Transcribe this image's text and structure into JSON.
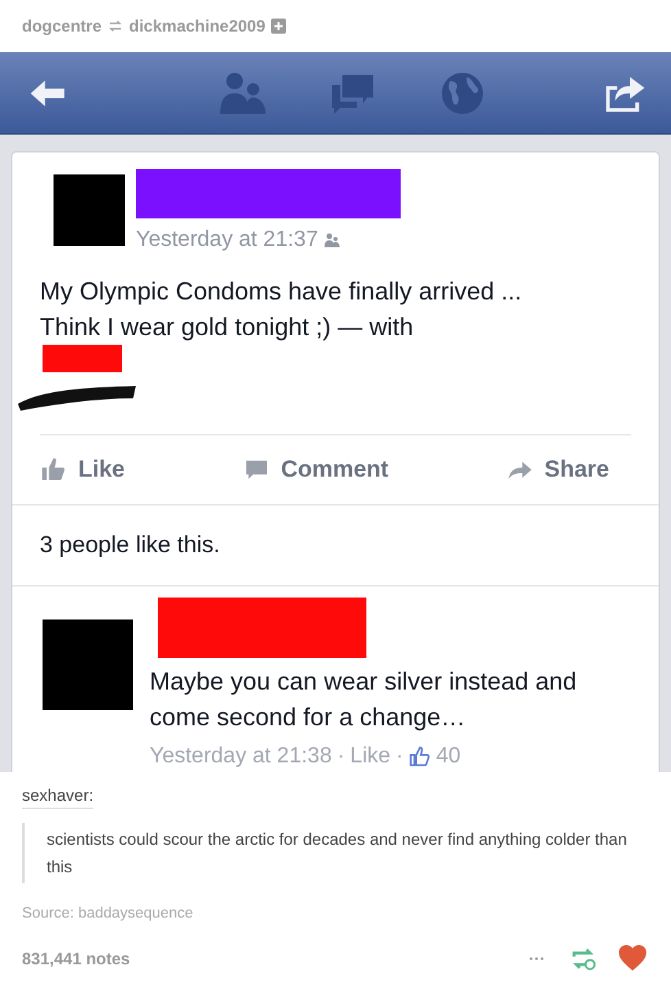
{
  "header": {
    "reblogger": "dogcentre",
    "source_blog": "dickmachine2009"
  },
  "post": {
    "time": "Yesterday at 21:37",
    "text": "My Olympic Condoms have finally arrived ... Think I wear gold tonight ;) — with",
    "actions": [
      "Like",
      "Comment",
      "Share"
    ],
    "likes": "3 people like this.",
    "comment": {
      "text": "Maybe you can wear silver instead and come second for a change…",
      "time": "Yesterday at 21:38",
      "separator": "·",
      "like": "Like",
      "like_count": "40"
    }
  },
  "reblog": {
    "author": "sexhaver:",
    "quote": "scientists could scour the arctic for decades and never find anything colder than this",
    "source": "Source: baddaysequence",
    "notes": "831,441 notes",
    "liked": true
  }
}
